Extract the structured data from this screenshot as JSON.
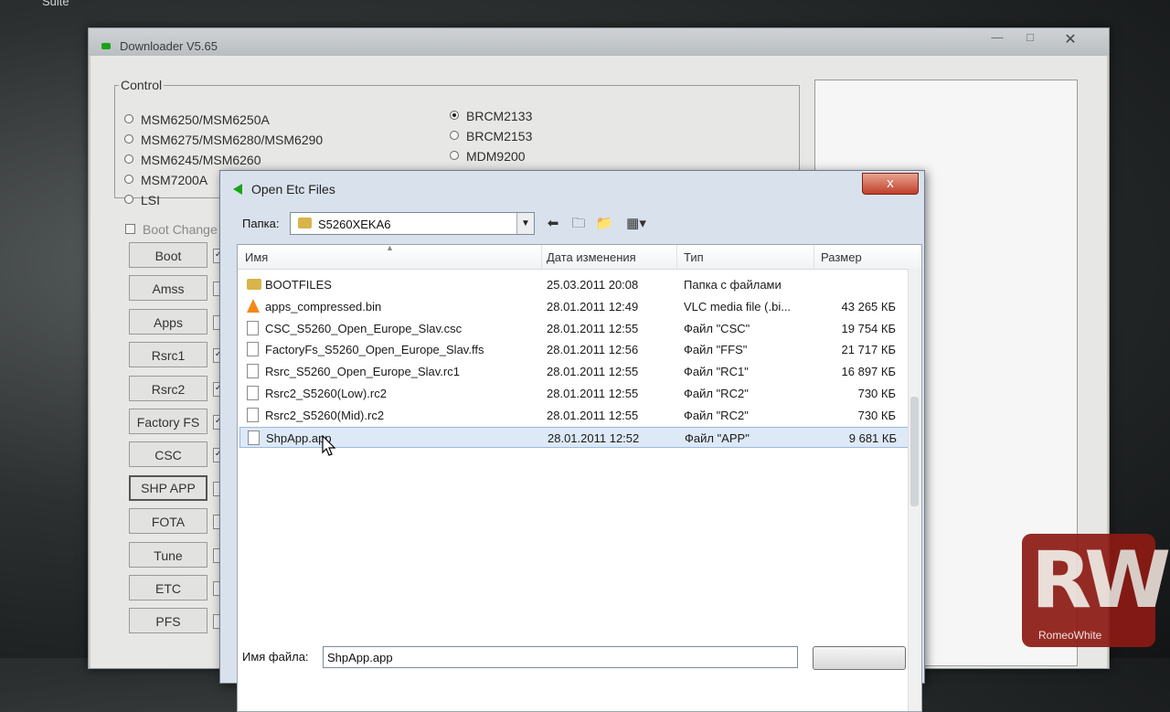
{
  "desktop": {
    "top_label": "Suite"
  },
  "downloader": {
    "title": "Downloader V5.65",
    "window_buttons": {
      "minimize": "—",
      "maximize": "□",
      "close": "✕"
    },
    "control_legend": "Control",
    "chipsets_left": [
      "MSM6250/MSM6250A",
      "MSM6275/MSM6280/MSM6290",
      "MSM6245/MSM6260",
      "MSM7200A",
      "LSI"
    ],
    "chipsets_right": [
      "BRCM2133",
      "BRCM2153",
      "MDM9200"
    ],
    "selected_chipset": "BRCM2133",
    "boot_change_label": "Boot Change",
    "file_buttons": [
      "Boot",
      "Amss",
      "Apps",
      "Rsrc1",
      "Rsrc2",
      "Factory FS",
      "CSC",
      "SHP APP",
      "FOTA",
      "Tune",
      "ETC",
      "PFS"
    ],
    "file_checks": [
      "✓",
      "",
      "",
      "✓",
      "✓",
      "✓",
      "✓",
      "",
      "",
      "",
      "",
      ""
    ]
  },
  "dialog": {
    "title": "Open Etc Files",
    "close_symbol": "x",
    "look_in_label": "Папка:",
    "look_in_value": "S5260XEKA6",
    "columns": [
      "Имя",
      "Дата изменения",
      "Тип",
      "Размер"
    ],
    "files": [
      {
        "name": "BOOTFILES",
        "date": "25.03.2011 20:08",
        "type": "Папка с файлами",
        "size": "",
        "icon": "folder-icon"
      },
      {
        "name": "apps_compressed.bin",
        "date": "28.01.2011 12:49",
        "type": "VLC media file (.bi...",
        "size": "43 265 КБ",
        "icon": "vlc-icon"
      },
      {
        "name": "CSC_S5260_Open_Europe_Slav.csc",
        "date": "28.01.2011 12:55",
        "type": "Файл \"CSC\"",
        "size": "19 754 КБ",
        "icon": "file-icon"
      },
      {
        "name": "FactoryFs_S5260_Open_Europe_Slav.ffs",
        "date": "28.01.2011 12:56",
        "type": "Файл \"FFS\"",
        "size": "21 717 КБ",
        "icon": "file-icon"
      },
      {
        "name": "Rsrc_S5260_Open_Europe_Slav.rc1",
        "date": "28.01.2011 12:55",
        "type": "Файл \"RC1\"",
        "size": "16 897 КБ",
        "icon": "file-icon"
      },
      {
        "name": "Rsrc2_S5260(Low).rc2",
        "date": "28.01.2011 12:55",
        "type": "Файл \"RC2\"",
        "size": "730 КБ",
        "icon": "file-icon"
      },
      {
        "name": "Rsrc2_S5260(Mid).rc2",
        "date": "28.01.2011 12:55",
        "type": "Файл \"RC2\"",
        "size": "730 КБ",
        "icon": "file-icon"
      },
      {
        "name": "ShpApp.app",
        "date": "28.01.2011 12:52",
        "type": "Файл \"APP\"",
        "size": "9 681 КБ",
        "icon": "file-icon"
      }
    ],
    "selected_file": "ShpApp.app",
    "filename_label": "Имя файла:",
    "filename_value": "ShpApp.app"
  },
  "watermark": {
    "logo": "RW",
    "name": "RomeoWhite"
  }
}
